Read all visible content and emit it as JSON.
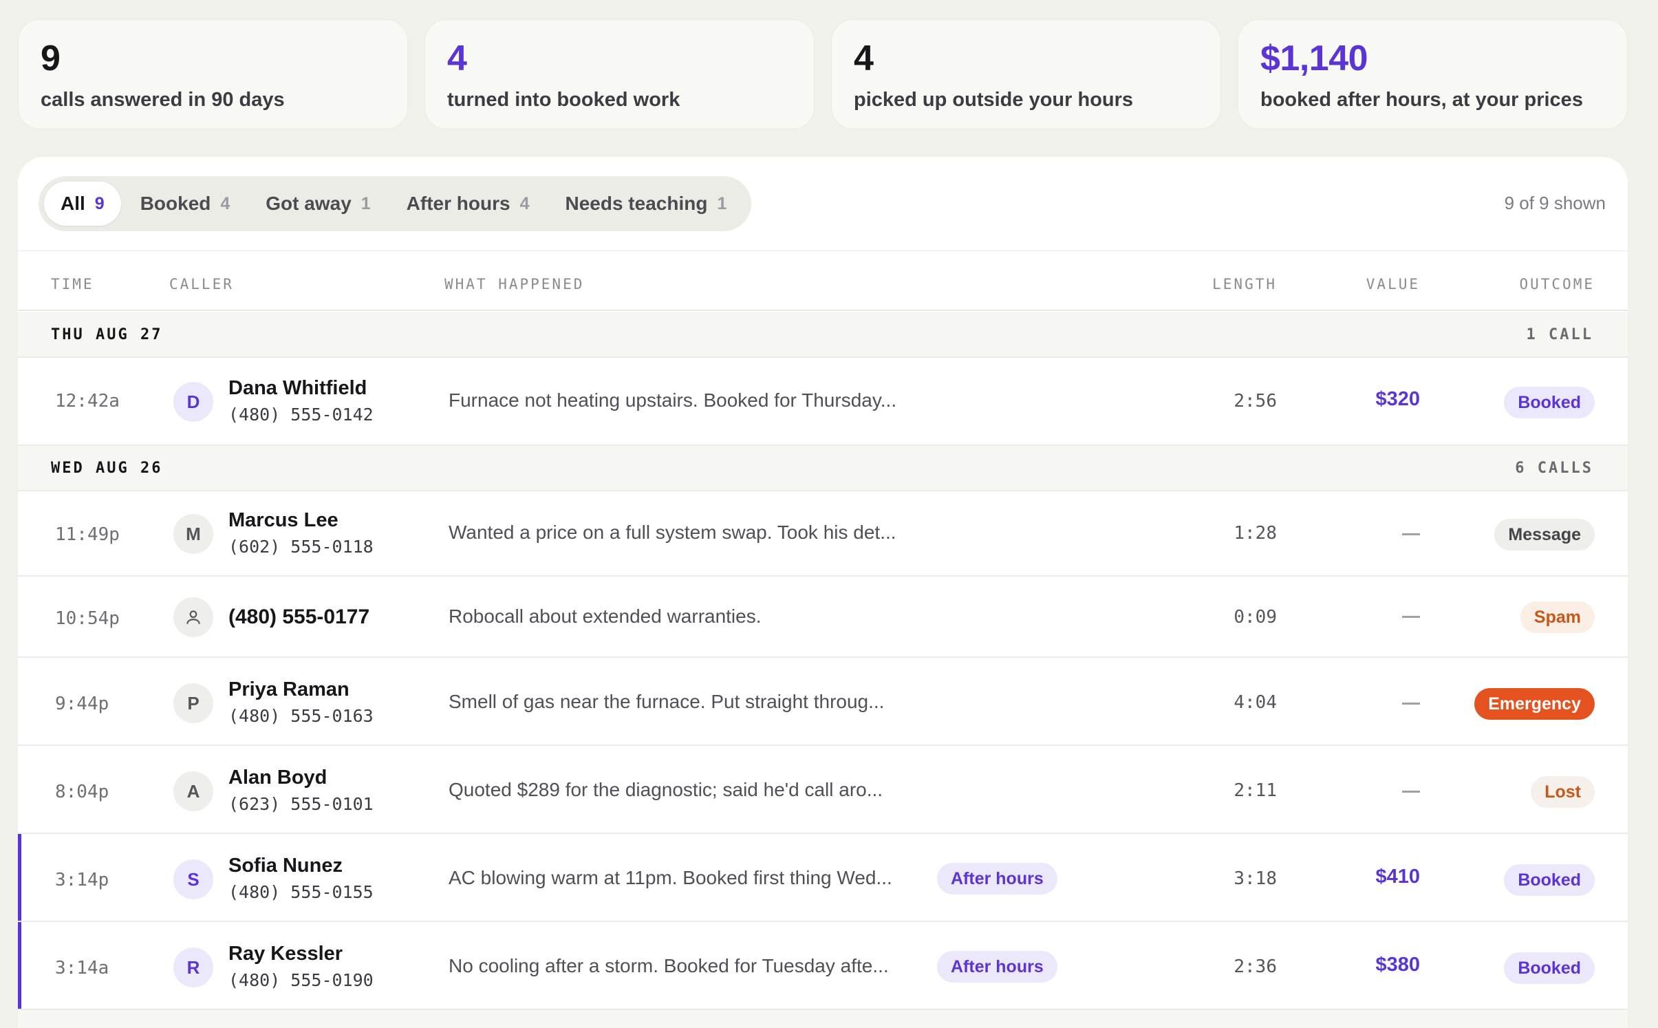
{
  "stats": [
    {
      "value": "9",
      "label": "calls answered in 90 days"
    },
    {
      "value": "4",
      "label": "turned into booked work"
    },
    {
      "value": "4",
      "label": "picked up outside your hours"
    },
    {
      "value": "$1,140",
      "label": "booked after hours, at your prices"
    }
  ],
  "tabs": [
    {
      "label": "All",
      "count": "9"
    },
    {
      "label": "Booked",
      "count": "4"
    },
    {
      "label": "Got away",
      "count": "1"
    },
    {
      "label": "After hours",
      "count": "4"
    },
    {
      "label": "Needs teaching",
      "count": "1"
    }
  ],
  "shown": "9 of 9 shown",
  "columns": {
    "time": "TIME",
    "caller": "CALLER",
    "what": "WHAT HAPPENED",
    "length": "LENGTH",
    "value": "VALUE",
    "outcome": "OUTCOME"
  },
  "days": [
    {
      "label": "THU AUG 27",
      "count": "1 CALL"
    },
    {
      "label": "WED AUG 26",
      "count": "6 CALLS"
    }
  ],
  "calls": [
    {
      "time": "12:42a",
      "initial": "D",
      "name": "Dana Whitfield",
      "phone": "(480) 555-0142",
      "what": "Furnace not heating upstairs. Booked for Thursday...",
      "length": "2:56",
      "value": "$320",
      "outcome": "Booked"
    },
    {
      "time": "11:49p",
      "initial": "M",
      "name": "Marcus Lee",
      "phone": "(602) 555-0118",
      "what": "Wanted a price on a full system swap. Took his det...",
      "length": "1:28",
      "value": "—",
      "outcome": "Message"
    },
    {
      "time": "10:54p",
      "initial": "person-icon",
      "name": "(480) 555-0177",
      "phone": "",
      "what": "Robocall about extended warranties.",
      "length": "0:09",
      "value": "—",
      "outcome": "Spam"
    },
    {
      "time": "9:44p",
      "initial": "P",
      "name": "Priya Raman",
      "phone": "(480) 555-0163",
      "what": "Smell of gas near the furnace. Put straight throug...",
      "length": "4:04",
      "value": "—",
      "outcome": "Emergency"
    },
    {
      "time": "8:04p",
      "initial": "A",
      "name": "Alan Boyd",
      "phone": "(623) 555-0101",
      "what": "Quoted $289 for the diagnostic; said he'd call aro...",
      "length": "2:11",
      "value": "—",
      "outcome": "Lost"
    },
    {
      "time": "3:14p",
      "initial": "S",
      "name": "Sofia Nunez",
      "phone": "(480) 555-0155",
      "what": "AC blowing warm at 11pm. Booked first thing Wed...",
      "tag": "After hours",
      "length": "3:18",
      "value": "$410",
      "outcome": "Booked"
    },
    {
      "time": "3:14a",
      "initial": "R",
      "name": "Ray Kessler",
      "phone": "(480) 555-0190",
      "what": "No cooling after a storm. Booked for Tuesday afte...",
      "tag": "After hours",
      "length": "2:36",
      "value": "$380",
      "outcome": "Booked"
    }
  ],
  "colors": {
    "accent": "#5b34d6",
    "emergency": "#e4521f",
    "spam": "#c8571c"
  }
}
